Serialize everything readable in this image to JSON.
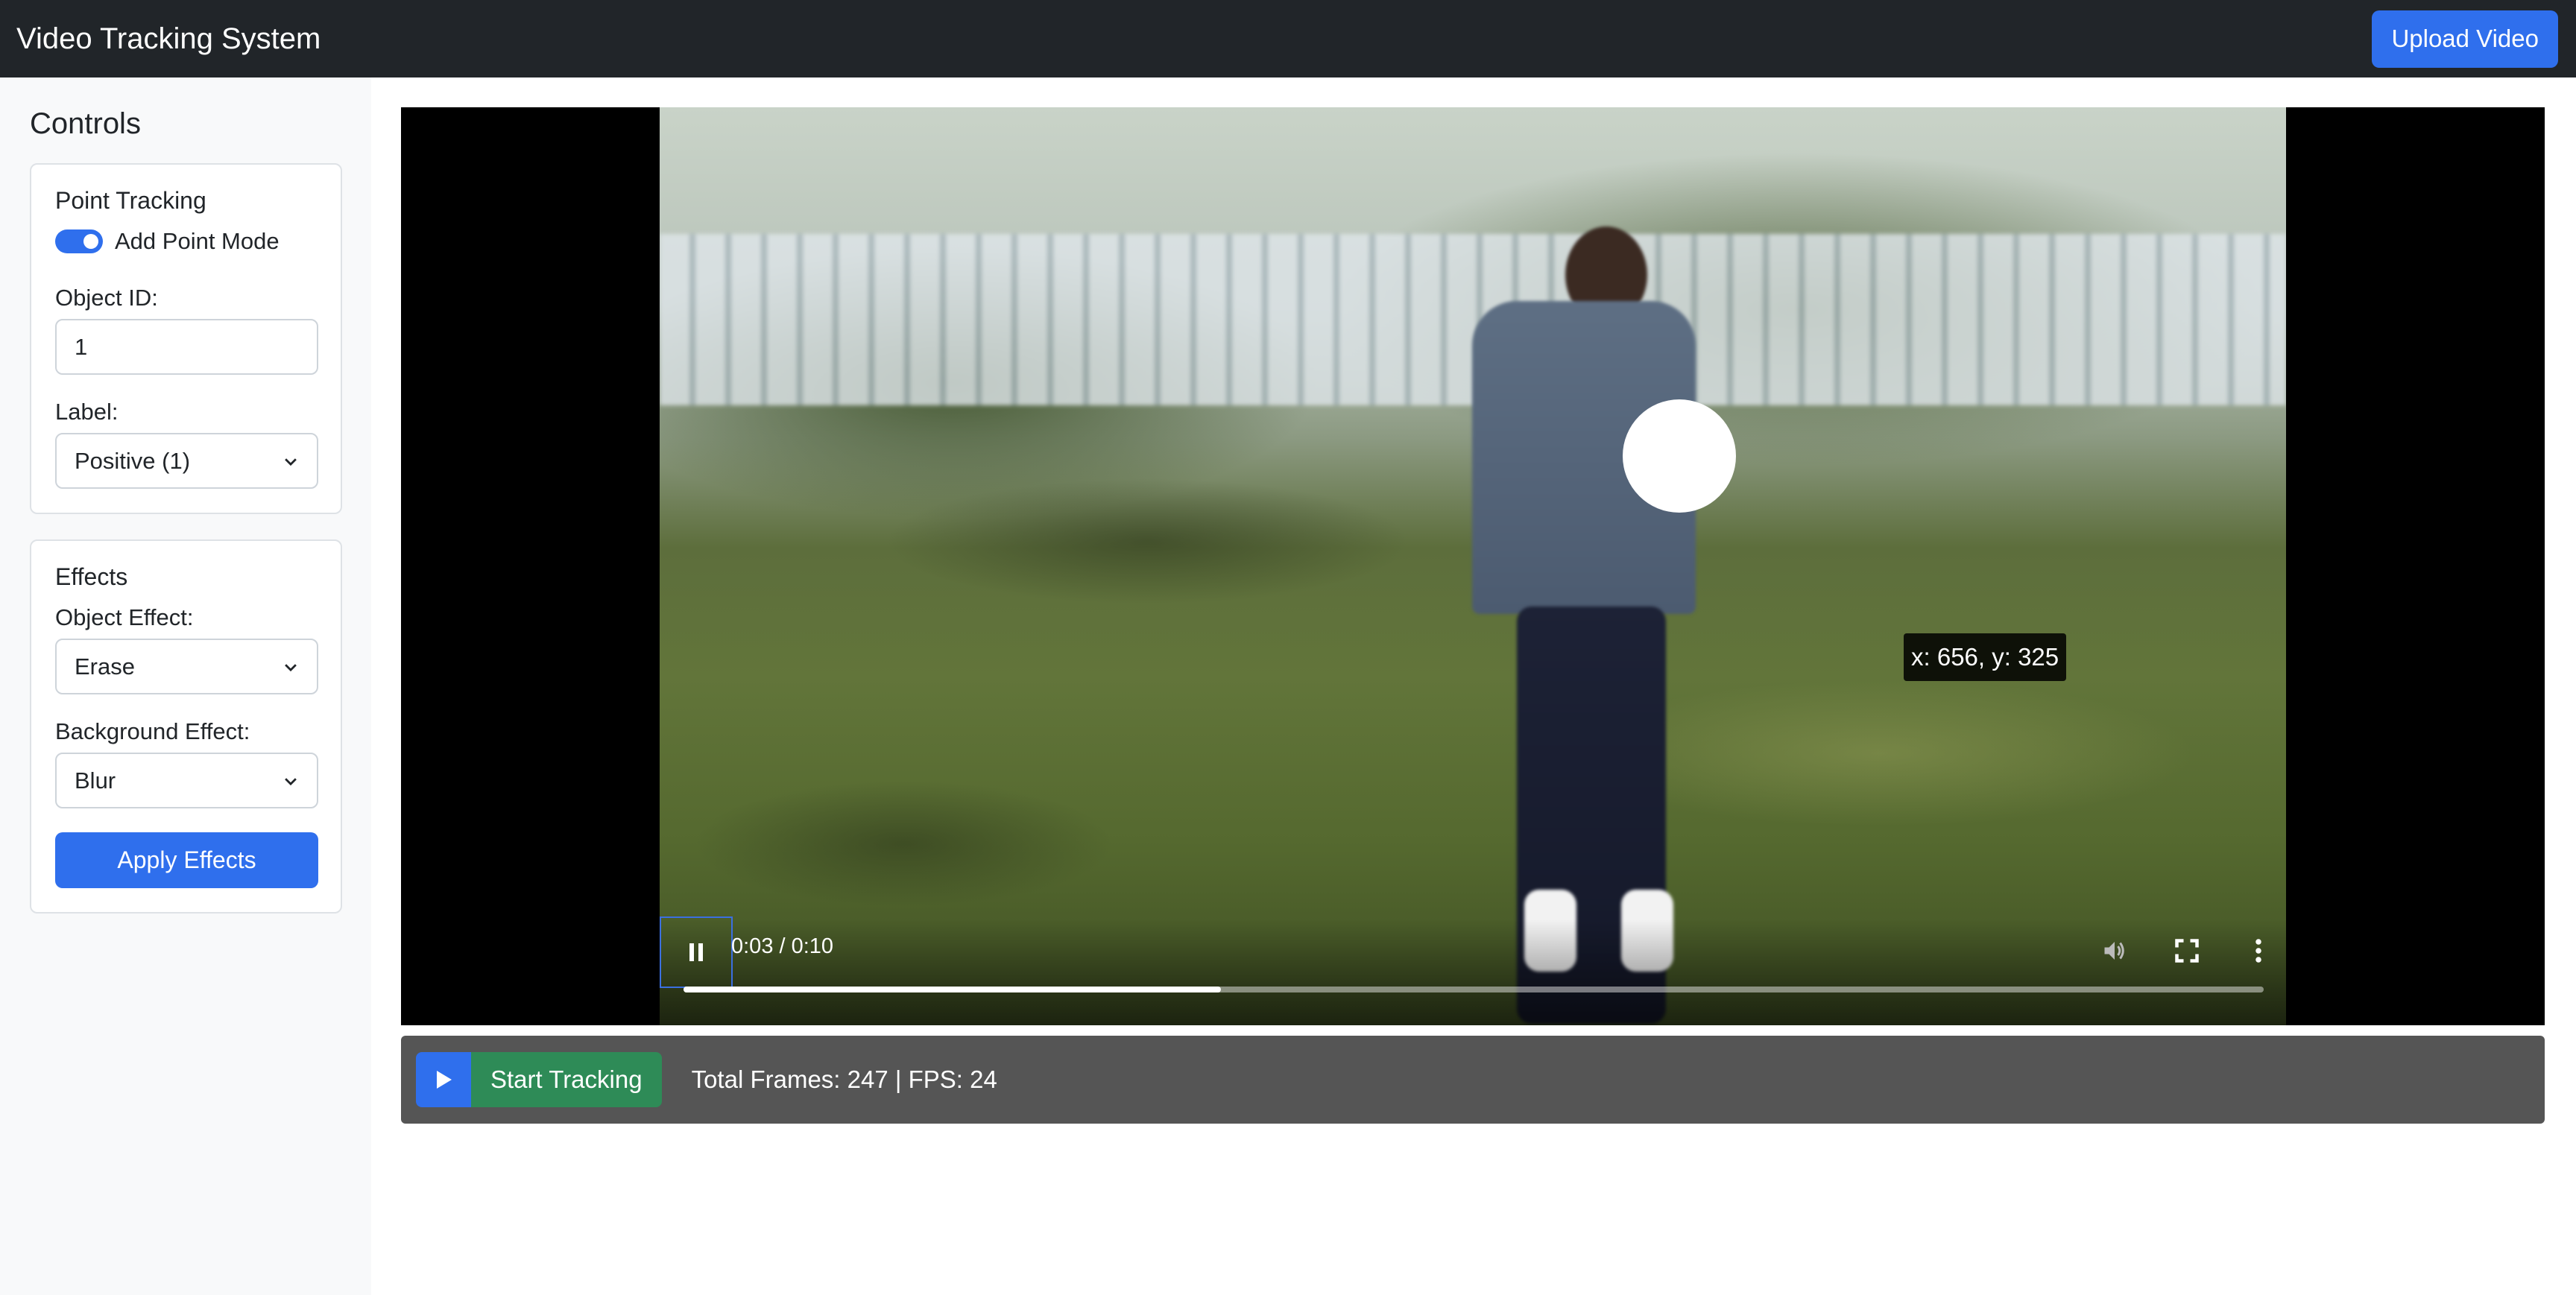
{
  "header": {
    "title": "Video Tracking System",
    "upload_label": "Upload Video"
  },
  "sidebar": {
    "title": "Controls",
    "point_tracking": {
      "title": "Point Tracking",
      "add_point_mode_label": "Add Point Mode",
      "add_point_mode_on": true,
      "object_id_label": "Object ID:",
      "object_id_value": "1",
      "label_label": "Label:",
      "label_value": "Positive (1)"
    },
    "effects": {
      "title": "Effects",
      "object_effect_label": "Object Effect:",
      "object_effect_value": "Erase",
      "background_effect_label": "Background Effect:",
      "background_effect_value": "Blur",
      "apply_label": "Apply Effects"
    }
  },
  "video": {
    "coord_tooltip": "x: 656, y: 325",
    "time_display": "0:03 / 0:10",
    "progress": 0.34,
    "state": "playing"
  },
  "tracking": {
    "start_label": "Start Tracking",
    "stats": "Total Frames: 247 | FPS: 24"
  },
  "colors": {
    "navbar": "#212529",
    "primary": "#2f6fed",
    "success": "#2e8b57",
    "tracking_bar": "#555555"
  }
}
